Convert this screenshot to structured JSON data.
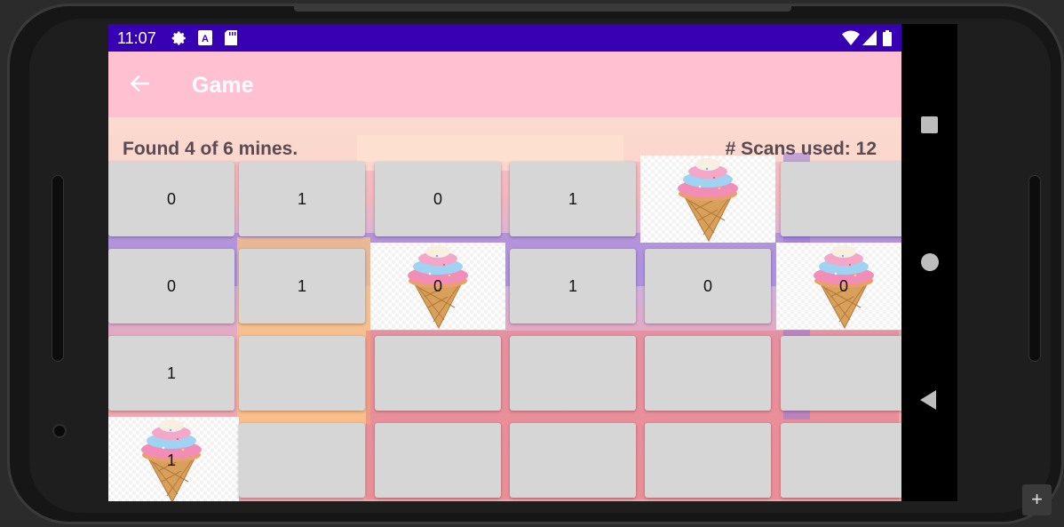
{
  "status_bar": {
    "time": "11:07",
    "left_icons": [
      "gear-icon",
      "a-letter-icon",
      "sd-card-icon"
    ],
    "right_icons": [
      "wifi-icon",
      "signal-icon",
      "battery-icon"
    ],
    "background": "#3700b3"
  },
  "app_bar": {
    "title": "Game",
    "back_icon": "arrow-left-icon",
    "background": "#ffc0d2"
  },
  "game": {
    "found_text": "Found 4 of 6 mines.",
    "scans_text": "# Scans used: 12",
    "grid": [
      [
        {
          "label": "0",
          "mine": false
        },
        {
          "label": "1",
          "mine": false
        },
        {
          "label": "0",
          "mine": false
        },
        {
          "label": "1",
          "mine": false
        },
        {
          "label": "",
          "mine": true
        },
        {
          "label": "",
          "mine": false
        }
      ],
      [
        {
          "label": "0",
          "mine": false
        },
        {
          "label": "1",
          "mine": false
        },
        {
          "label": "0",
          "mine": true
        },
        {
          "label": "1",
          "mine": false
        },
        {
          "label": "0",
          "mine": false
        },
        {
          "label": "0",
          "mine": true
        }
      ],
      [
        {
          "label": "1",
          "mine": false
        },
        {
          "label": "",
          "mine": false
        },
        {
          "label": "",
          "mine": false
        },
        {
          "label": "",
          "mine": false
        },
        {
          "label": "",
          "mine": false
        },
        {
          "label": "",
          "mine": false
        }
      ],
      [
        {
          "label": "1",
          "mine": true
        },
        {
          "label": "",
          "mine": false
        },
        {
          "label": "",
          "mine": false
        },
        {
          "label": "",
          "mine": false
        },
        {
          "label": "",
          "mine": false
        },
        {
          "label": "",
          "mine": false
        }
      ]
    ],
    "mine_icon": "ice-cream-cone-icon"
  },
  "nav_bar": {
    "icons": [
      "recents-square-icon",
      "home-circle-icon",
      "back-triangle-icon"
    ]
  },
  "emulator": {
    "plus_label": "+"
  }
}
